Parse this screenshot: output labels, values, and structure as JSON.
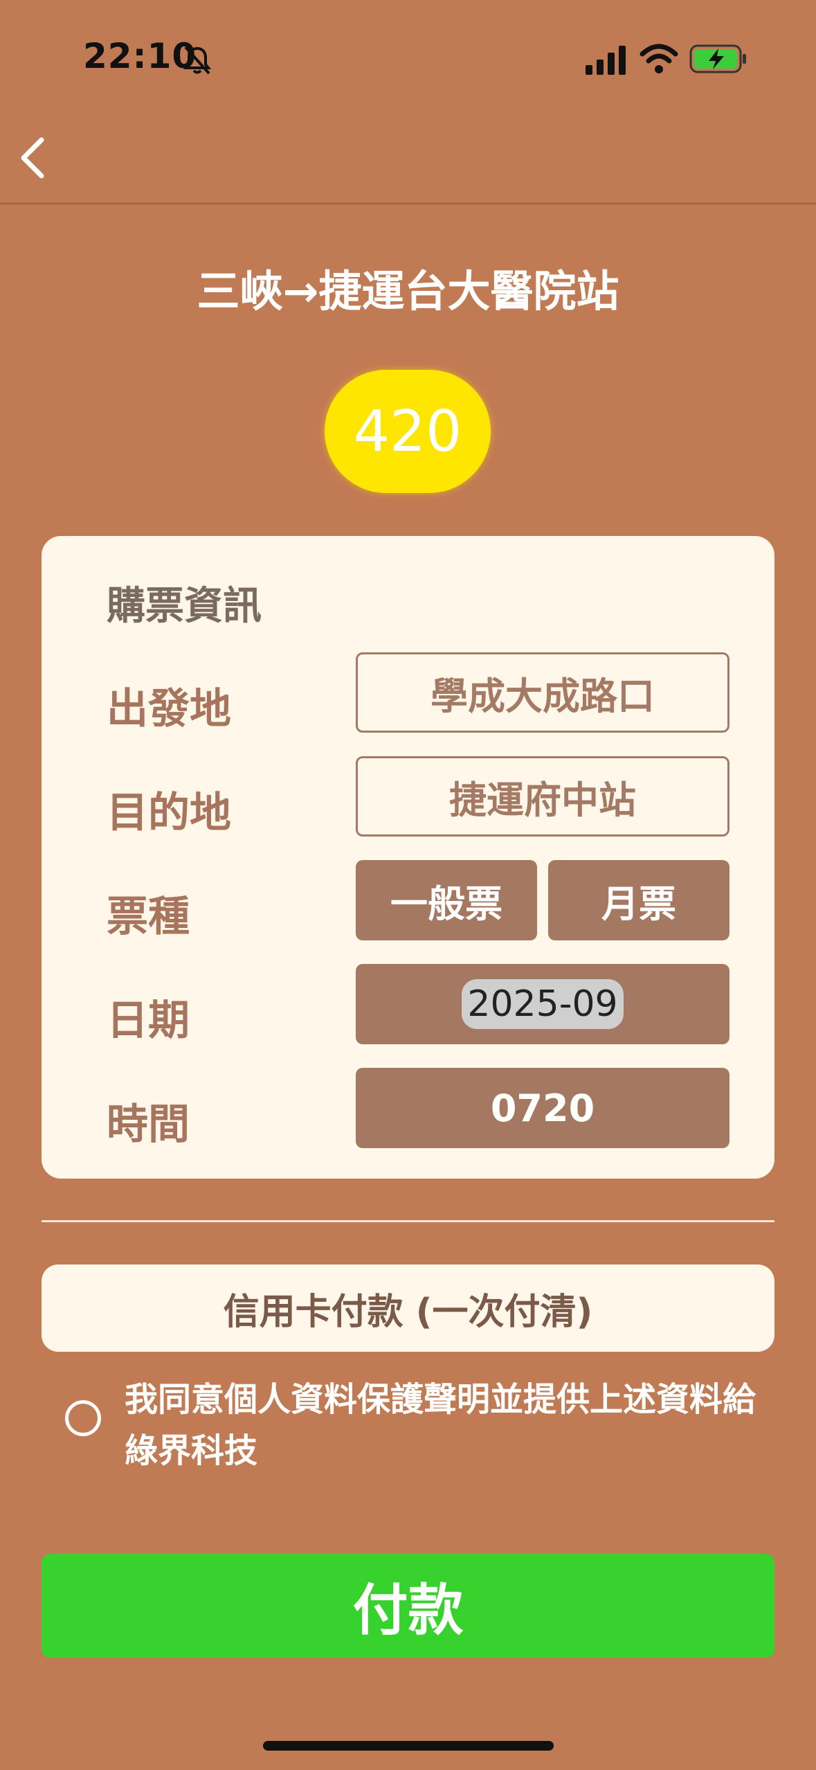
{
  "status_bar": {
    "time": "22:10",
    "icons": [
      "bell-slash-icon",
      "cellular-signal-icon",
      "wifi-icon",
      "battery-charging-icon"
    ]
  },
  "nav": {
    "back_icon": "chevron-left-icon"
  },
  "route": {
    "title": "三峽→捷運台大醫院站"
  },
  "price": "420",
  "ticket_info": {
    "heading": "購票資訊",
    "origin_label": "出發地",
    "origin_value": "學成大成路口",
    "destination_label": "目的地",
    "destination_value": "捷運府中站",
    "ticket_type_label": "票種",
    "ticket_types": [
      "一般票",
      "月票"
    ],
    "date_label": "日期",
    "date_value": "2025-09",
    "time_label": "時間",
    "time_value": "0720"
  },
  "payment": {
    "method": "信用卡付款 (一次付清)",
    "consent_text": "我同意個人資料保護聲明並提供上述資料給綠界科技",
    "pay_button": "付款"
  },
  "colors": {
    "background": "#c17b54",
    "price_badge": "#ffe600",
    "card": "#fff8ea",
    "filled_field": "#a57961",
    "pay_button": "#38d22f"
  }
}
